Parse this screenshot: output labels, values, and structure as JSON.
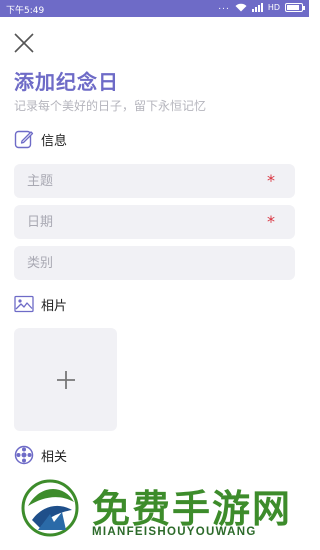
{
  "status_bar": {
    "time": "下午5:49",
    "dots": "...",
    "network": "HD",
    "battery_level": 0.9,
    "bg_color": "#6e6bc7"
  },
  "header": {
    "close_icon": "close-icon",
    "title": "添加纪念日",
    "subtitle": "记录每个美好的日子，留下永恒记忆"
  },
  "info_section": {
    "icon": "edit-icon",
    "label": "信息",
    "fields": [
      {
        "placeholder": "主题",
        "required": true,
        "required_mark": "*"
      },
      {
        "placeholder": "日期",
        "required": true,
        "required_mark": "*"
      },
      {
        "placeholder": "类别",
        "required": false
      }
    ]
  },
  "photo_section": {
    "icon": "image-icon",
    "label": "相片",
    "add_icon": "plus-icon"
  },
  "related_section": {
    "icon": "related-icon",
    "label": "相关"
  },
  "watermark": {
    "title": "免费手游网",
    "subtitle": "MIANFEISHOUYOUWANG"
  },
  "colors": {
    "accent": "#6e6bc7",
    "field_bg": "#f1f1f5",
    "required": "#d9333f",
    "placeholder": "#a9a9b3",
    "watermark_green": "#3d8c2b"
  }
}
